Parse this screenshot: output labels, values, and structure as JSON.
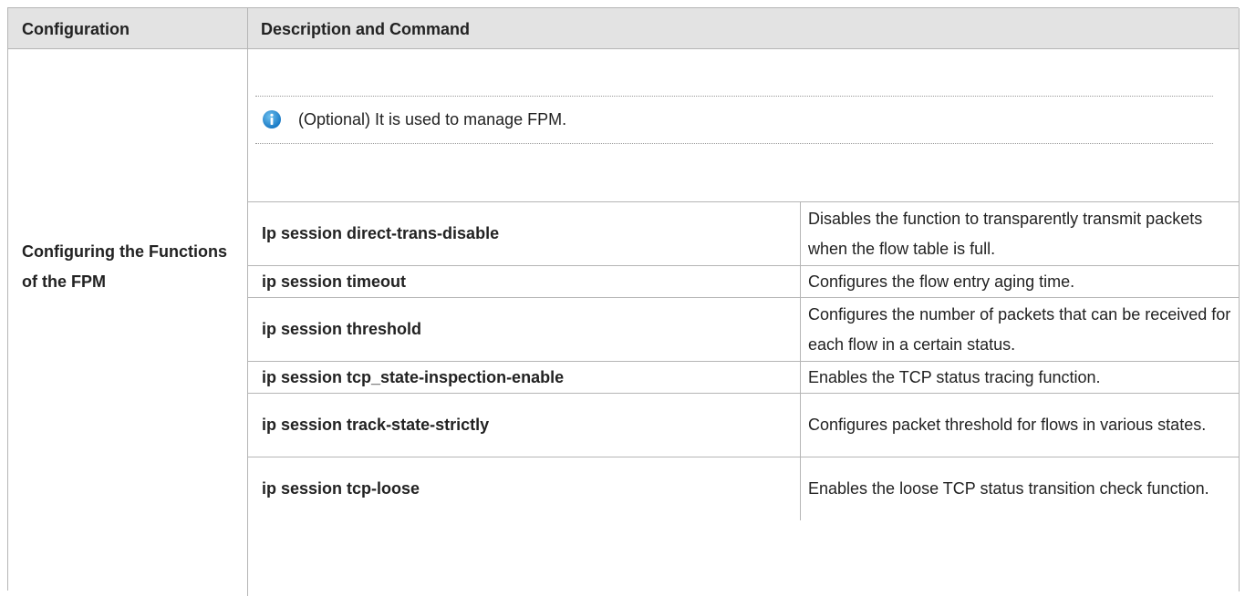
{
  "table": {
    "header": {
      "col1": "Configuration",
      "col2": "Description and Command"
    },
    "section_label": "Configuring the Functions of the FPM",
    "note": {
      "icon": "info-icon",
      "text": "(Optional) It is used to manage FPM."
    },
    "rows": [
      {
        "command": "Ip session direct-trans-disable",
        "description": "Disables the function to transparently transmit packets when the flow table is full."
      },
      {
        "command": "ip session timeout",
        "description": "Configures the flow entry aging time."
      },
      {
        "command": "ip session threshold",
        "description": "Configures the number of packets that can be received for each flow in a certain status."
      },
      {
        "command": "ip session tcp_state-inspection-enable",
        "description": "Enables the TCP status tracing function."
      },
      {
        "command": "ip session track-state-strictly",
        "description": "Configures packet threshold for flows in various states."
      },
      {
        "command": "ip session tcp-loose",
        "description": "Enables the loose TCP status transition check function."
      }
    ]
  }
}
